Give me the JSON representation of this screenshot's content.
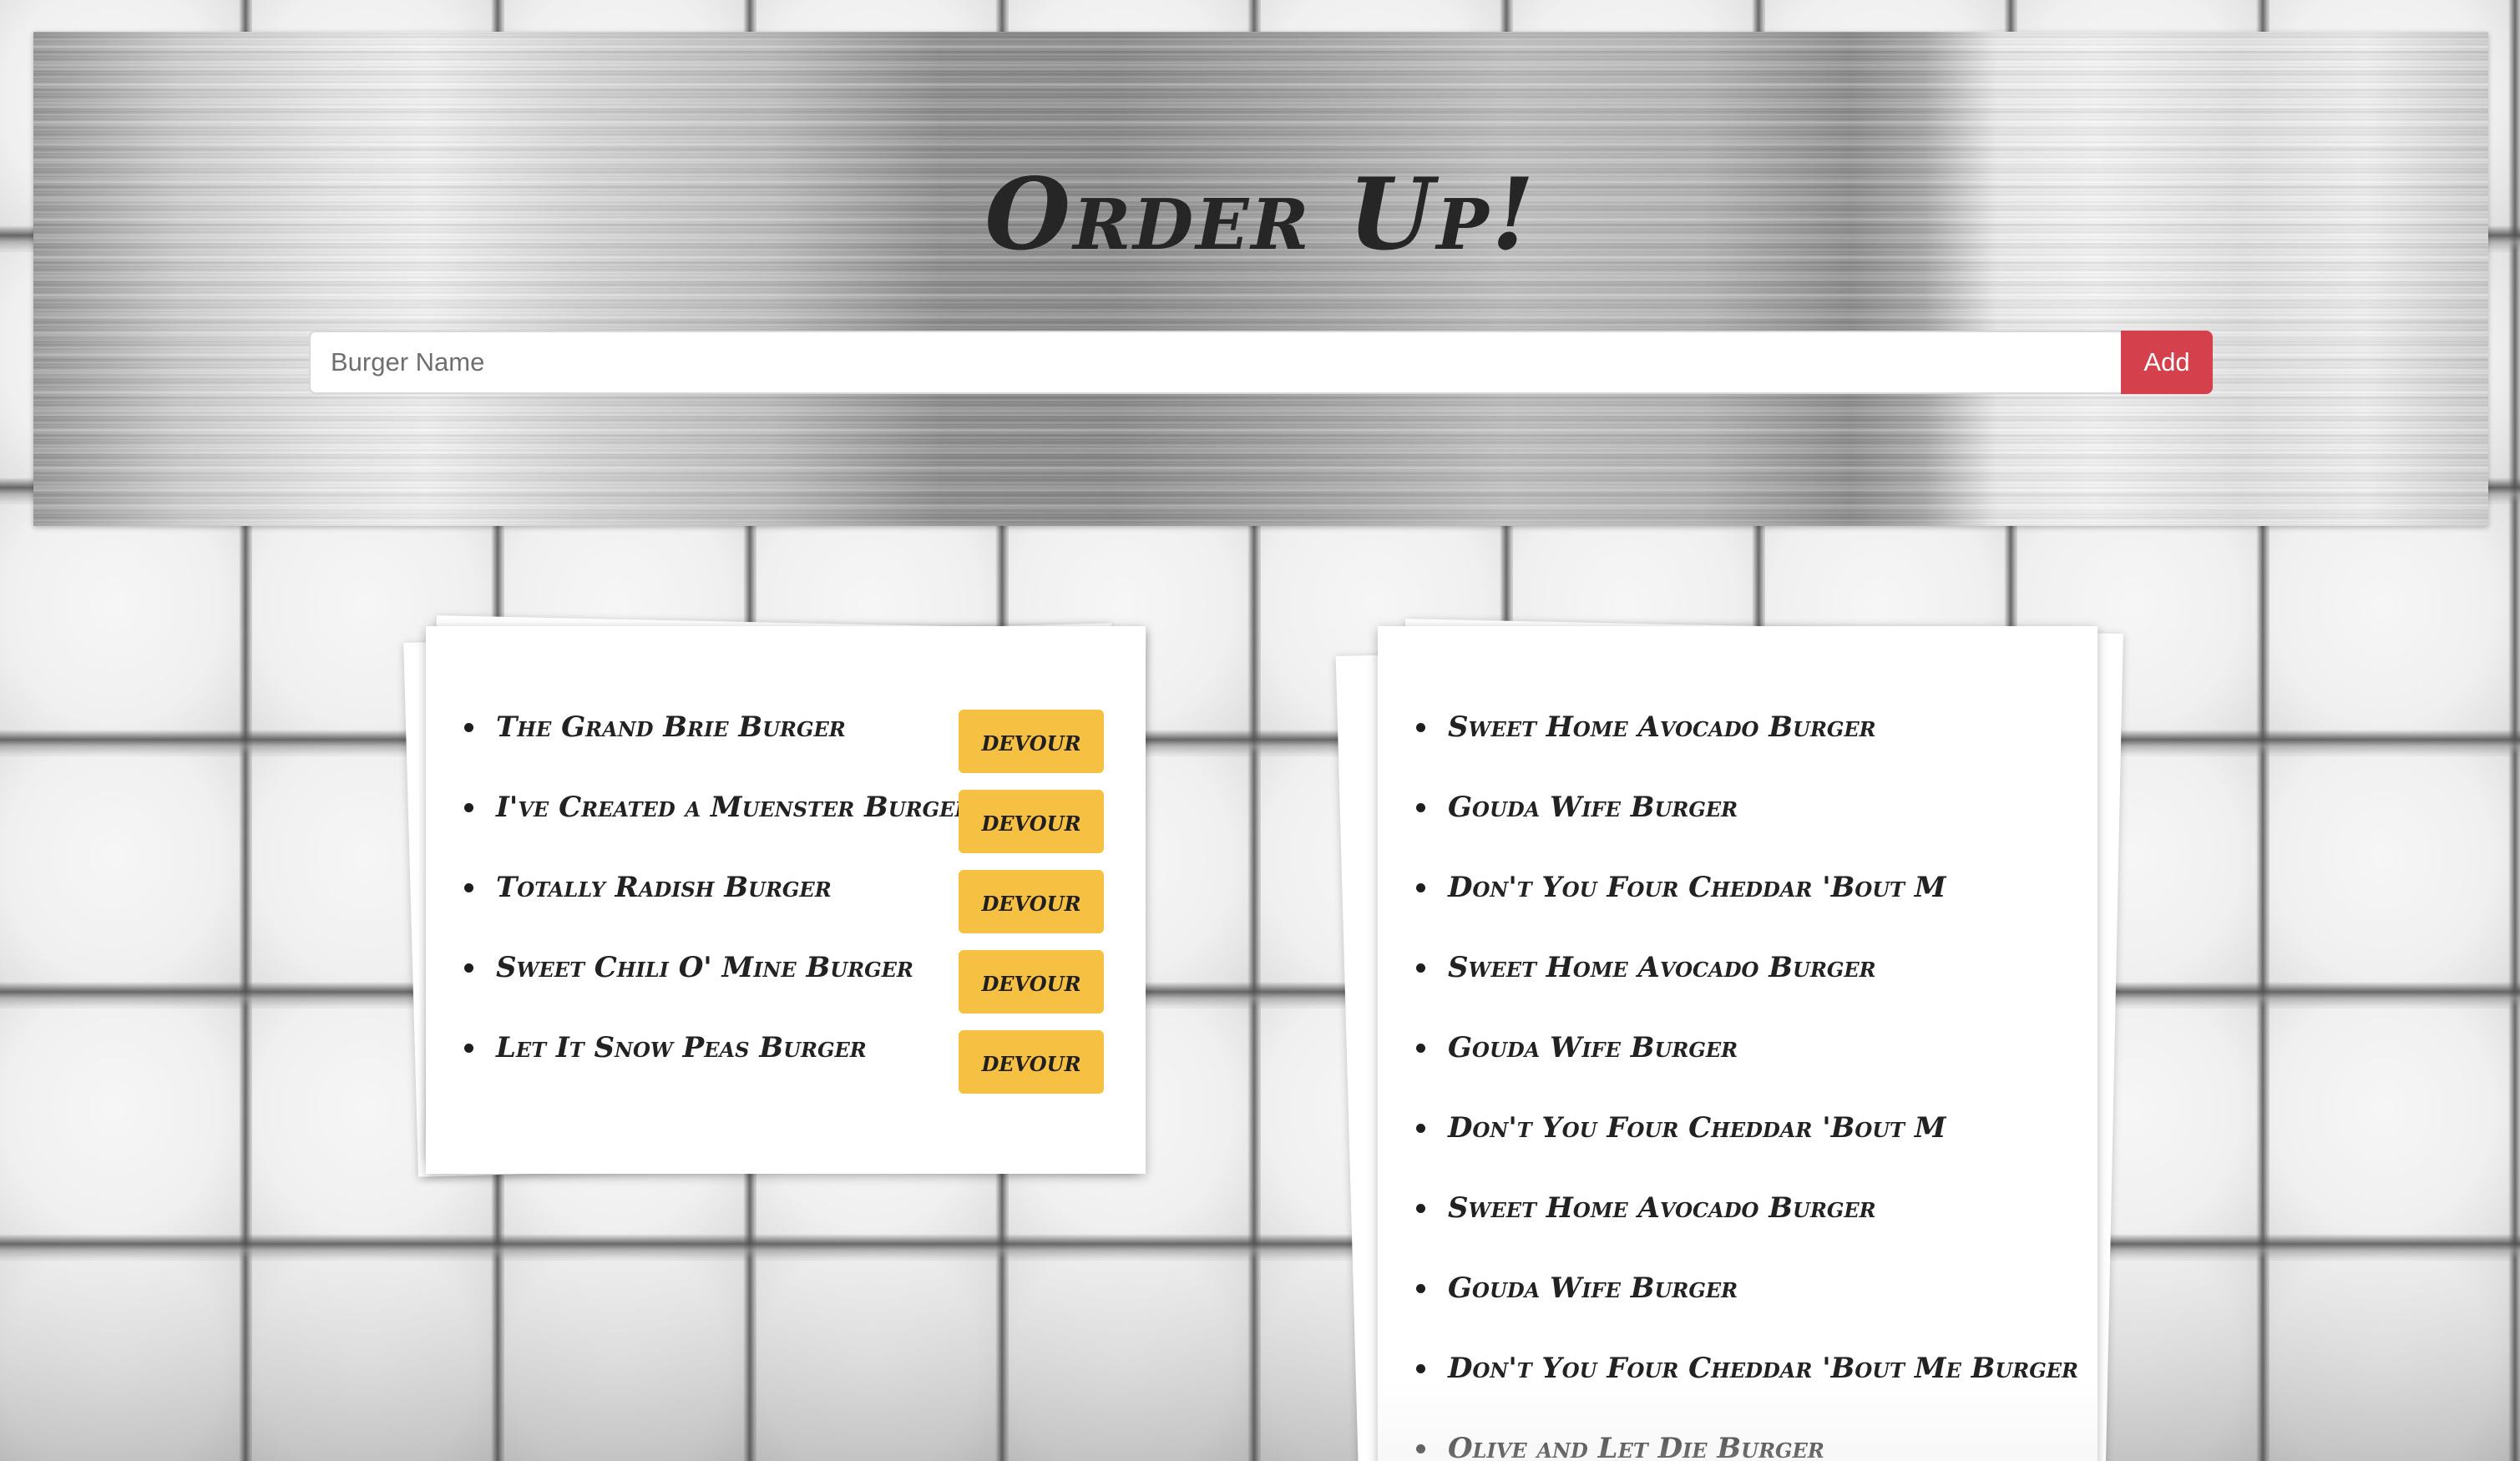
{
  "header": {
    "title": "Order Up!",
    "input_placeholder": "Burger Name",
    "input_value": "",
    "add_label": "Add"
  },
  "left_list": {
    "button_label": "devour",
    "items": [
      "The Grand Brie Burger",
      "I've Created a Muenster Burger",
      "Totally Radish Burger",
      "Sweet Chili O' Mine Burger",
      "Let It Snow Peas Burger"
    ]
  },
  "right_list": {
    "items": [
      "Sweet Home Avocado Burger",
      "Gouda Wife Burger",
      "Don't You Four Cheddar 'Bout M",
      "Sweet Home Avocado Burger",
      "Gouda Wife Burger",
      "Don't You Four Cheddar 'Bout M",
      "Sweet Home Avocado Burger",
      "Gouda Wife Burger",
      "Don't You Four Cheddar 'Bout Me Burger",
      "Olive and Let Die Burger"
    ]
  },
  "colors": {
    "add_button": "#d4404c",
    "devour_button": "#f6c043",
    "title_text": "#262626"
  }
}
